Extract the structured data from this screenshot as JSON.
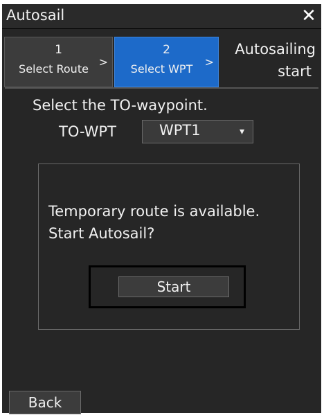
{
  "window": {
    "title": "Autosail",
    "close_icon": "close-icon"
  },
  "steps": [
    {
      "number": "1",
      "label": "Select Route",
      "arrow": ">",
      "state": "done"
    },
    {
      "number": "2",
      "label": "Select WPT",
      "arrow": ">",
      "state": "active"
    },
    {
      "line1": "Autosailing",
      "line2": "start",
      "state": "pending"
    }
  ],
  "main": {
    "instruction": "Select the TO-waypoint.",
    "to_wpt_label": "TO-WPT",
    "to_wpt_value": "WPT1",
    "dropdown_caret": "▾",
    "message_line1": "Temporary route is available.",
    "message_line2": "Start Autosail?",
    "start_label": "Start"
  },
  "footer": {
    "back_label": "Back"
  },
  "colors": {
    "background": "#262626",
    "active_step": "#1d6ac9",
    "button": "#3c3c3c",
    "text": "#f0f0f0"
  }
}
